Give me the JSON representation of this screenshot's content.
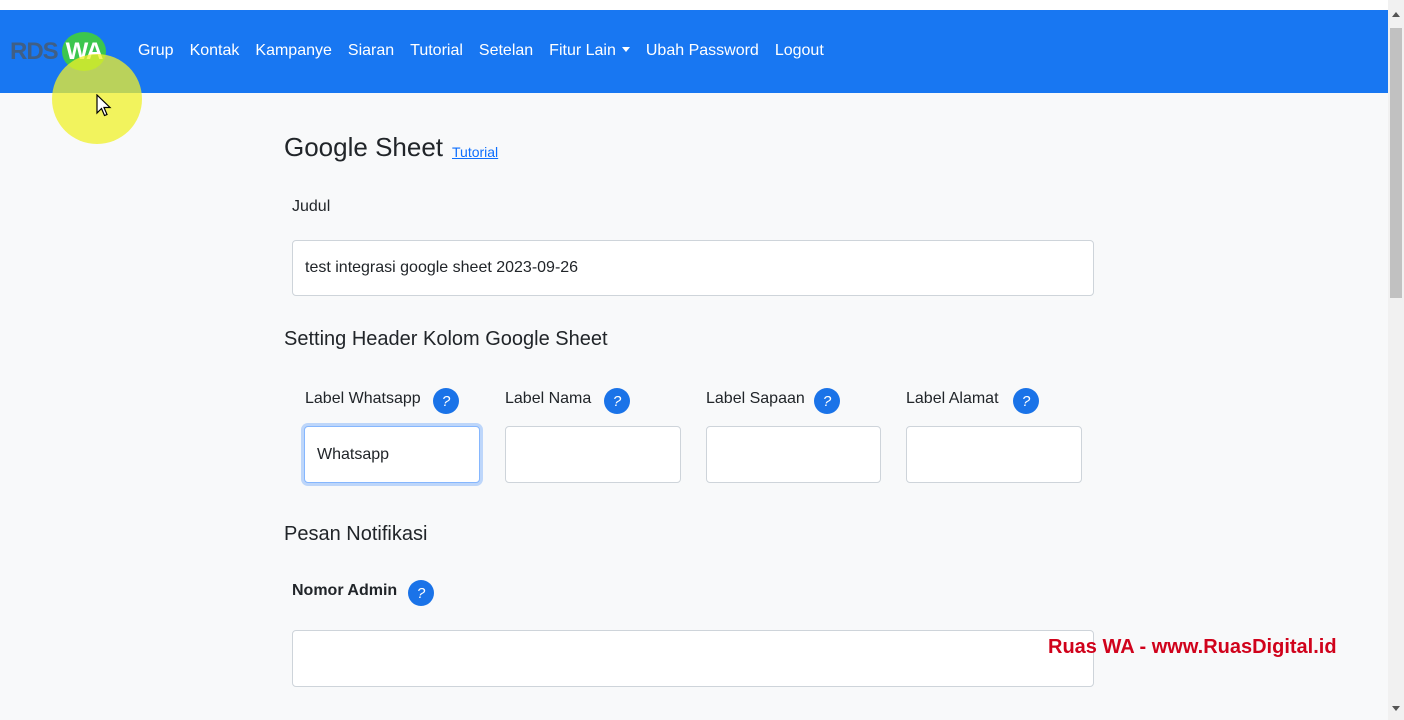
{
  "brand": {
    "part1": "RDS",
    "part2": "WA"
  },
  "nav": {
    "items": [
      {
        "label": "Grup"
      },
      {
        "label": "Kontak"
      },
      {
        "label": "Kampanye"
      },
      {
        "label": "Siaran"
      },
      {
        "label": "Tutorial"
      },
      {
        "label": "Setelan"
      },
      {
        "label": "Fitur Lain"
      },
      {
        "label": "Ubah Password"
      },
      {
        "label": "Logout"
      }
    ]
  },
  "page": {
    "title": "Google Sheet",
    "tutorial_link": "Tutorial"
  },
  "judul": {
    "label": "Judul",
    "value": "test integrasi google sheet 2023-09-26"
  },
  "header_section": {
    "title": "Setting Header Kolom Google Sheet",
    "fields": [
      {
        "label": "Label Whatsapp",
        "value": "Whatsapp"
      },
      {
        "label": "Label Nama",
        "value": ""
      },
      {
        "label": "Label Sapaan",
        "value": ""
      },
      {
        "label": "Label Alamat",
        "value": ""
      }
    ]
  },
  "notif_section": {
    "title": "Pesan Notifikasi",
    "nomor_admin_label": "Nomor Admin",
    "nomor_admin_value": ""
  },
  "help_glyph": "?",
  "watermark": "Ruas WA - www.RuasDigital.id",
  "colors": {
    "navbar": "#1877f2",
    "help": "#1a73e8",
    "watermark": "#d0021b"
  }
}
